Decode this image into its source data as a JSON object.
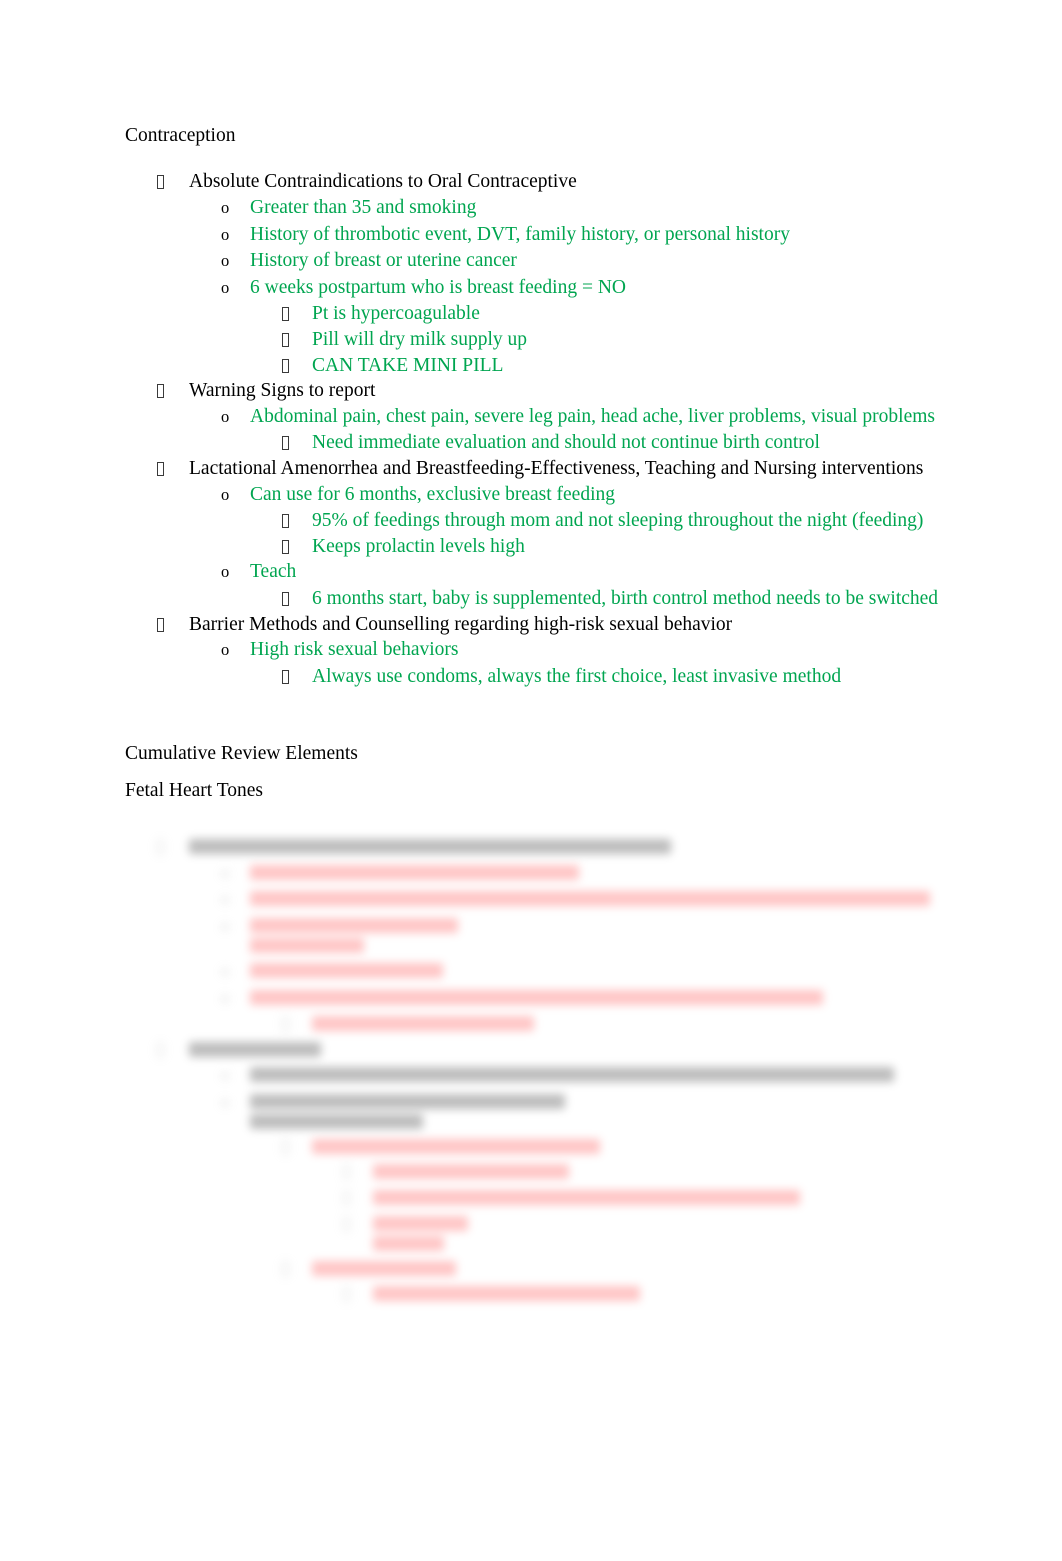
{
  "document": {
    "title": "Contraception",
    "section_headings": {
      "cumulative_review": "Cumulative Review Elements",
      "fetal_heart_tones": "Fetal Heart Tones"
    },
    "markers": {
      "level1": "□",
      "level2": "o",
      "level3": "□",
      "level4": "□"
    },
    "colors": {
      "body_text": "#000000",
      "highlight_green": "#00a550",
      "highlight_red": "#ff4242",
      "page_background": "#ffffff"
    }
  },
  "contraception": {
    "heading": "Contraception",
    "items": [
      {
        "level": 1,
        "color": "black",
        "text": "Absolute Contraindications to Oral Contraceptive"
      },
      {
        "level": 2,
        "color": "green",
        "text": "Greater than 35 and smoking"
      },
      {
        "level": 2,
        "color": "green",
        "text": "History of thrombotic event, DVT, family history, or personal history"
      },
      {
        "level": 2,
        "color": "green",
        "text": "History of breast or uterine cancer"
      },
      {
        "level": 2,
        "color": "green",
        "text": "6 weeks postpartum who is breast feeding = NO"
      },
      {
        "level": 3,
        "color": "green",
        "text": "Pt is hypercoagulable"
      },
      {
        "level": 3,
        "color": "green",
        "text": "Pill will dry milk supply up"
      },
      {
        "level": 3,
        "color": "green",
        "text": "CAN TAKE MINI PILL"
      },
      {
        "level": 1,
        "color": "black",
        "text": "Warning Signs to report"
      },
      {
        "level": 2,
        "color": "green",
        "text": "Abdominal pain, chest pain, severe leg pain, head ache, liver problems, visual problems"
      },
      {
        "level": 3,
        "color": "green",
        "text": "Need immediate evaluation and should not continue birth control"
      },
      {
        "level": 1,
        "color": "black",
        "text": "Lactational Amenorrhea and Breastfeeding-Effectiveness, Teaching and Nursing interventions"
      },
      {
        "level": 2,
        "color": "green",
        "text": "Can use for 6 months, exclusive breast feeding"
      },
      {
        "level": 3,
        "color": "green",
        "text": "95% of feedings through mom and not sleeping throughout the night (feeding)"
      },
      {
        "level": 3,
        "color": "green",
        "text": "Keeps prolactin levels high"
      },
      {
        "level": 2,
        "color": "green",
        "text": "Teach"
      },
      {
        "level": 3,
        "color": "green",
        "text": "6 months start, baby is supplemented, birth control method needs to be switched"
      },
      {
        "level": 1,
        "color": "black",
        "text": "Barrier Methods and Counselling regarding high-risk sexual behavior"
      },
      {
        "level": 2,
        "color": "green",
        "text": "High risk sexual behaviors"
      },
      {
        "level": 3,
        "color": "green",
        "text": "Always use condoms, always the first choice, least invasive method"
      }
    ]
  },
  "cumulative_review": {
    "heading": "Cumulative Review Elements"
  },
  "fetal_heart_tones": {
    "heading": "Fetal Heart Tones",
    "note": "This section is visually blurred/redacted in the screenshot; its text is not legible.",
    "items": [
      {
        "level": 1,
        "color": "black",
        "width_pct": 62,
        "text": ""
      },
      {
        "level": 2,
        "color": "red",
        "width_pct": 46,
        "text": ""
      },
      {
        "level": 2,
        "color": "red",
        "width_pct": 95,
        "text": ""
      },
      {
        "level": 2,
        "color": "red",
        "width_pct": 29,
        "wrap": true,
        "text": ""
      },
      {
        "level": 2,
        "color": "red",
        "width_pct": 27,
        "text": ""
      },
      {
        "level": 2,
        "color": "red",
        "width_pct": 80,
        "text": ""
      },
      {
        "level": 3,
        "color": "red",
        "width_pct": 34,
        "text": ""
      },
      {
        "level": 1,
        "color": "black",
        "width_pct": 17,
        "text": ""
      },
      {
        "level": 2,
        "color": "black",
        "width_pct": 90,
        "text": ""
      },
      {
        "level": 2,
        "color": "black",
        "width_pct": 44,
        "wrap": true,
        "text": ""
      },
      {
        "level": 3,
        "color": "red",
        "width_pct": 44,
        "text": ""
      },
      {
        "level": 4,
        "color": "red",
        "width_pct": 33,
        "text": ""
      },
      {
        "level": 4,
        "color": "red",
        "width_pct": 72,
        "text": ""
      },
      {
        "level": 4,
        "color": "red",
        "width_pct": 16,
        "wrap": true,
        "text": ""
      },
      {
        "level": 3,
        "color": "red",
        "width_pct": 22,
        "text": ""
      },
      {
        "level": 4,
        "color": "red",
        "width_pct": 45,
        "text": ""
      }
    ]
  }
}
